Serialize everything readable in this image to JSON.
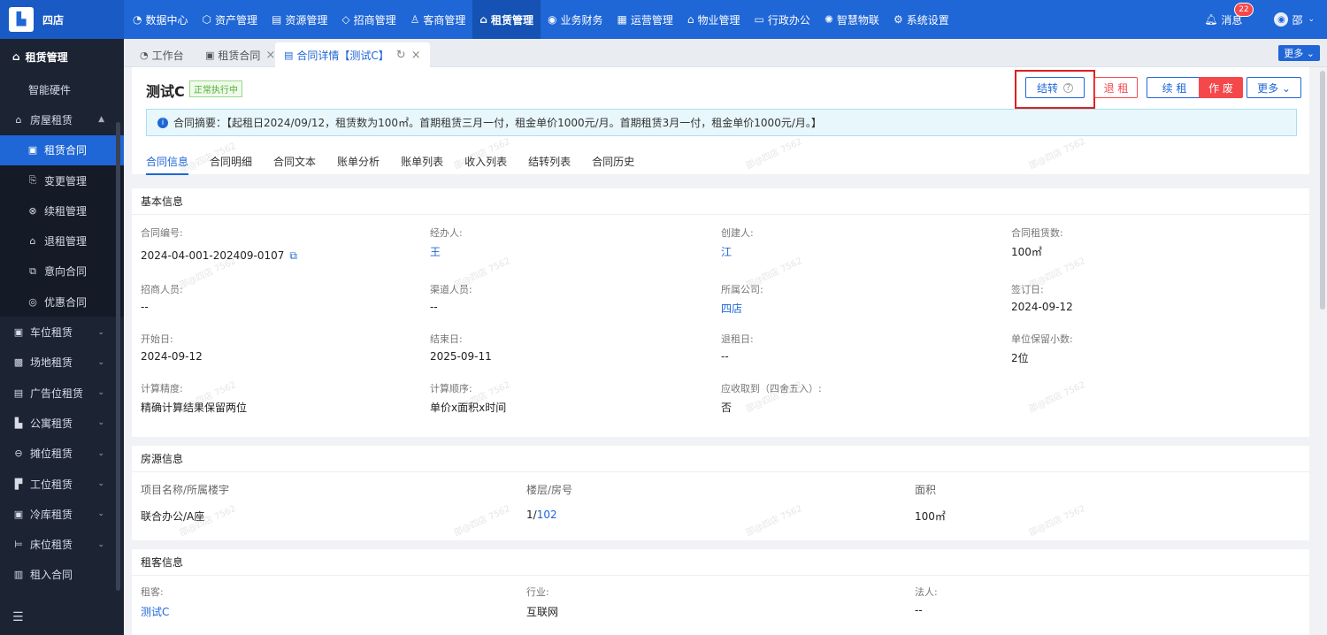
{
  "brand": {
    "name": "四店"
  },
  "topnav": {
    "items": [
      {
        "icon": "◔",
        "label": "数据中心"
      },
      {
        "icon": "⬡",
        "label": "资产管理"
      },
      {
        "icon": "▤",
        "label": "资源管理"
      },
      {
        "icon": "◇",
        "label": "招商管理"
      },
      {
        "icon": "♙",
        "label": "客商管理"
      },
      {
        "icon": "⌂",
        "label": "租赁管理"
      },
      {
        "icon": "◉",
        "label": "业务财务"
      },
      {
        "icon": "▦",
        "label": "运营管理"
      },
      {
        "icon": "⌂",
        "label": "物业管理"
      },
      {
        "icon": "▭",
        "label": "行政办公"
      },
      {
        "icon": "✺",
        "label": "智慧物联"
      },
      {
        "icon": "⚙",
        "label": "系统设置"
      }
    ],
    "active_index": 5,
    "messages_label": "消息",
    "messages_count": "22",
    "user_name": "邵"
  },
  "sidebar": {
    "header": "租赁管理",
    "items": [
      {
        "label": "智能硬件",
        "level": "plain"
      },
      {
        "label": "房屋租赁",
        "level": "l1",
        "icon": "⌂",
        "caret": "▲"
      },
      {
        "label": "租赁合同",
        "level": "l2",
        "icon": "▣",
        "active": true
      },
      {
        "label": "变更管理",
        "level": "l2",
        "icon": "⎘"
      },
      {
        "label": "续租管理",
        "level": "l2",
        "icon": "⊗"
      },
      {
        "label": "退租管理",
        "level": "l2",
        "icon": "⌂"
      },
      {
        "label": "意向合同",
        "level": "l2",
        "icon": "⧉"
      },
      {
        "label": "优惠合同",
        "level": "l2",
        "icon": "◎"
      },
      {
        "label": "车位租赁",
        "level": "l1",
        "icon": "▣",
        "caret": "⌄"
      },
      {
        "label": "场地租赁",
        "level": "l1",
        "icon": "▩",
        "caret": "⌄"
      },
      {
        "label": "广告位租赁",
        "level": "l1",
        "icon": "▤",
        "caret": "⌄"
      },
      {
        "label": "公寓租赁",
        "level": "l1",
        "icon": "▙",
        "caret": "⌄"
      },
      {
        "label": "摊位租赁",
        "level": "l1",
        "icon": "⊖",
        "caret": "⌄"
      },
      {
        "label": "工位租赁",
        "level": "l1",
        "icon": "▛",
        "caret": "⌄"
      },
      {
        "label": "冷库租赁",
        "level": "l1",
        "icon": "▣",
        "caret": "⌄"
      },
      {
        "label": "床位租赁",
        "level": "l1",
        "icon": "⊨",
        "caret": "⌄"
      },
      {
        "label": "租入合同",
        "level": "l1",
        "icon": "▥"
      }
    ]
  },
  "tabs": {
    "items": [
      {
        "icon": "◔",
        "label": "工作台"
      },
      {
        "icon": "▣",
        "label": "租赁合同"
      },
      {
        "icon": "▤",
        "label": "合同详情【测试C】"
      }
    ],
    "more_label": "更多 ⌄"
  },
  "contract": {
    "title": "测试C",
    "status": "正常执行中",
    "buttons": {
      "transfer": "结转",
      "quit": "退 租",
      "renew": "续 租",
      "void": "作 废",
      "more": "更多 ⌄"
    },
    "summary": "合同摘要：【起租日2024/09/12，租赁数为100㎡。首期租赁三月一付，租金单价1000元/月。首期租赁3月一付，租金单价1000元/月。】",
    "content_tabs": [
      "合同信息",
      "合同明细",
      "合同文本",
      "账单分析",
      "账单列表",
      "收入列表",
      "结转列表",
      "合同历史"
    ]
  },
  "basic_info": {
    "title": "基本信息",
    "fields": [
      {
        "label": "合同编号:",
        "value": "2024-04-001-202409-0107"
      },
      {
        "label": "经办人:",
        "value": "王"
      },
      {
        "label": "创建人:",
        "value": "江"
      },
      {
        "label": "合同租赁数:",
        "value": "100㎡"
      },
      {
        "label": "招商人员:",
        "value": "--"
      },
      {
        "label": "渠道人员:",
        "value": "--"
      },
      {
        "label": "所属公司:",
        "value": "四店"
      },
      {
        "label": "签订日:",
        "value": "2024-09-12"
      },
      {
        "label": "开始日:",
        "value": "2024-09-12"
      },
      {
        "label": "结束日:",
        "value": "2025-09-11"
      },
      {
        "label": "退租日:",
        "value": "--"
      },
      {
        "label": "单位保留小数:",
        "value": "2位"
      },
      {
        "label": "计算精度:",
        "value": "精确计算结果保留两位"
      },
      {
        "label": "计算顺序:",
        "value": "单价x面积x时间"
      },
      {
        "label": "应收取到（四舍五入）:",
        "value": "否"
      }
    ]
  },
  "room_info": {
    "title": "房源信息",
    "headers": [
      "项目名称/所属楼宇",
      "楼层/房号",
      "面积"
    ],
    "row": {
      "project": "联合办公/A座",
      "floor": "1/",
      "room": "102",
      "area": "100㎡"
    }
  },
  "tenant_info": {
    "title": "租客信息",
    "fields": [
      {
        "label": "租客:",
        "value": "测试C"
      },
      {
        "label": "行业:",
        "value": "互联网"
      },
      {
        "label": "法人:",
        "value": "--"
      }
    ]
  },
  "watermark": "邵@四店 7562"
}
